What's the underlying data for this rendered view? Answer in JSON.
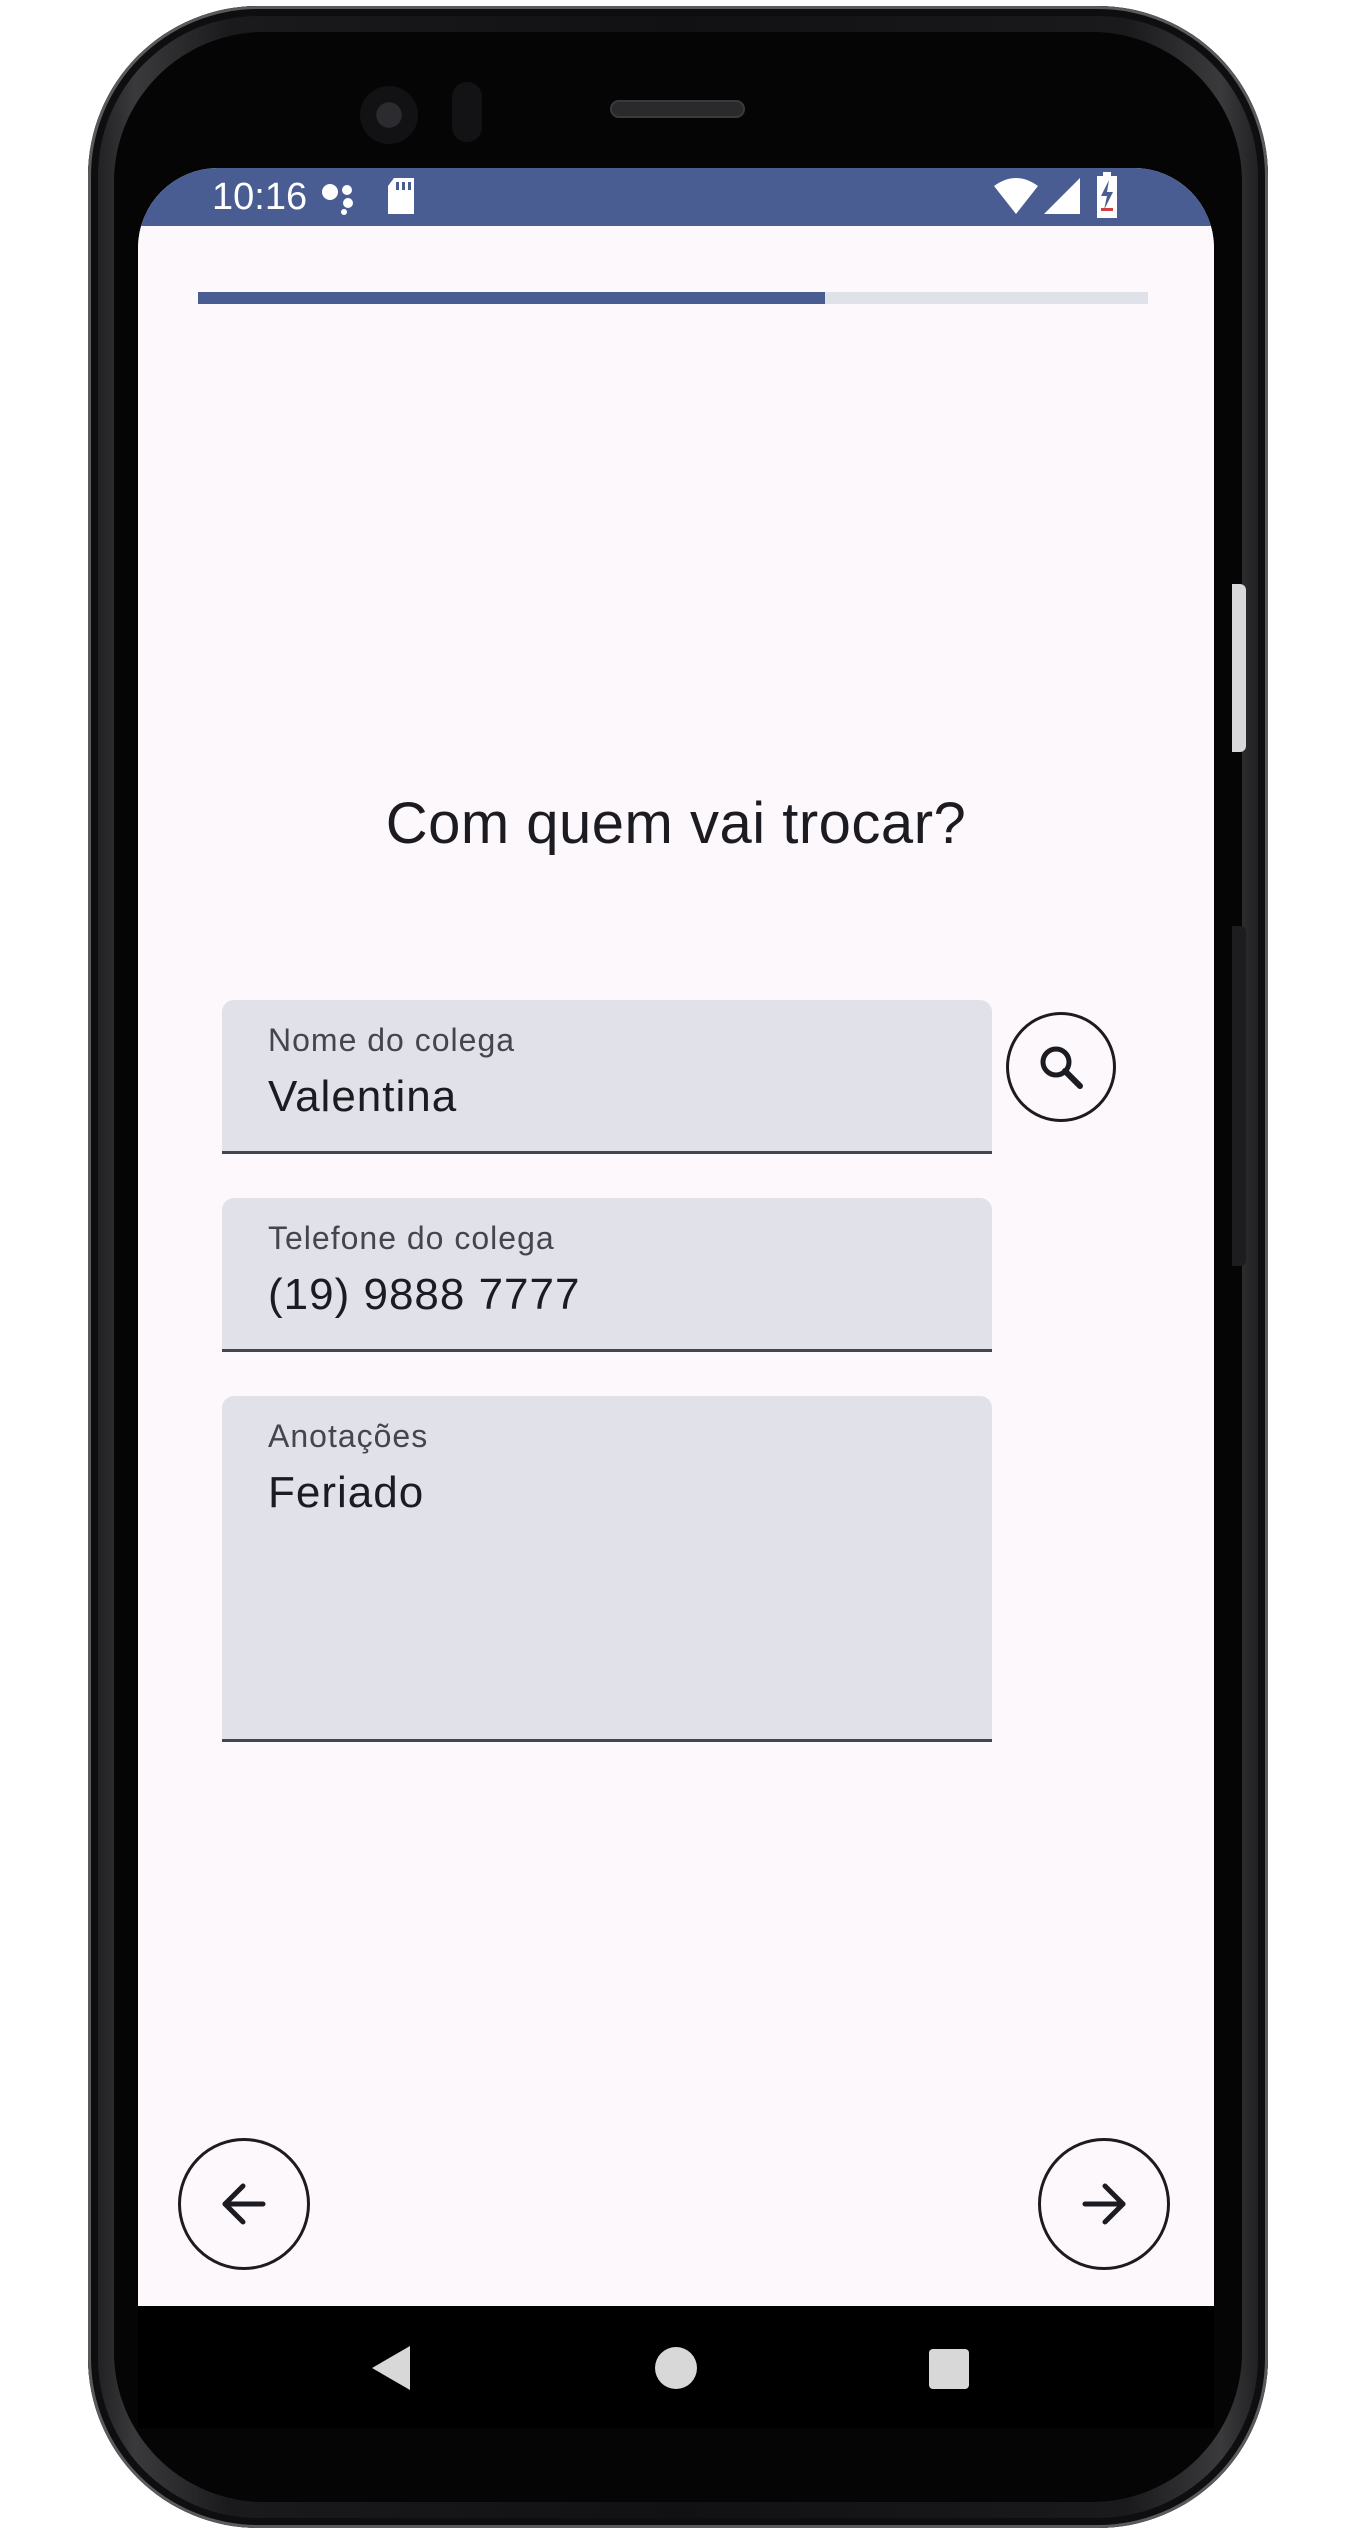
{
  "status_bar": {
    "time": "10:16",
    "bg_color": "#4a5d92",
    "icons": [
      "assistant-dots-icon",
      "sd-card-icon",
      "wifi-icon",
      "cellular-signal-icon",
      "battery-charging-icon"
    ]
  },
  "progress": {
    "fraction": 0.66,
    "fill_color": "#4a5d92"
  },
  "screen": {
    "question": "Com quem vai trocar?"
  },
  "form": {
    "name": {
      "label": "Nome do colega",
      "value": "Valentina"
    },
    "phone": {
      "label": "Telefone do colega",
      "value": "(19) 9888 7777"
    },
    "notes": {
      "label": "Anotações",
      "value": "Feriado"
    }
  },
  "buttons": {
    "search_icon": "search-icon",
    "back_icon": "arrow-left-icon",
    "next_icon": "arrow-right-icon"
  },
  "system_nav": {
    "icons": [
      "back-triangle-icon",
      "home-circle-icon",
      "recents-square-icon"
    ]
  }
}
